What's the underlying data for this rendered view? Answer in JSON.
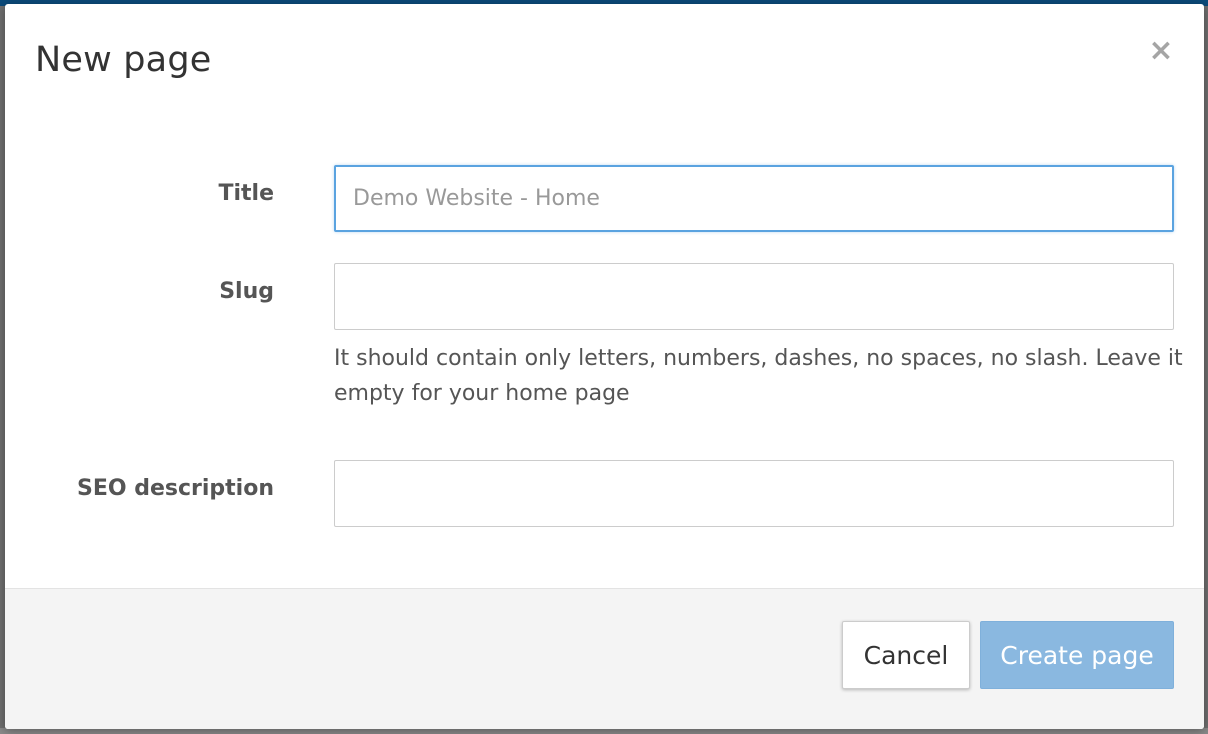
{
  "dialog": {
    "title": "New page",
    "close_symbol": "×"
  },
  "form": {
    "title": {
      "label": "Title",
      "value": "",
      "placeholder": "Demo Website - Home"
    },
    "slug": {
      "label": "Slug",
      "value": "",
      "placeholder": "",
      "help": "It should contain only letters, numbers, dashes, no spaces, no slash. Leave it empty for your home page"
    },
    "seo": {
      "label": "SEO description",
      "value": "",
      "placeholder": ""
    }
  },
  "footer": {
    "cancel_label": "Cancel",
    "create_label": "Create page"
  },
  "colors": {
    "primary_disabled": "#8ab8e0",
    "focus_border": "#5aa3e0"
  }
}
